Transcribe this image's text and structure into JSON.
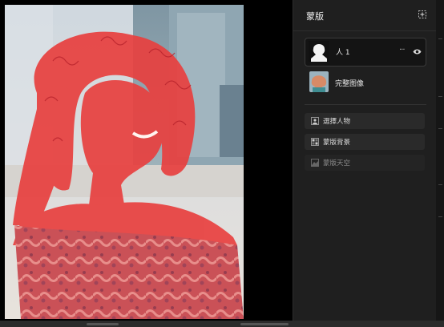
{
  "panel": {
    "title": "蒙版",
    "header_icon": "add-mask-icon"
  },
  "layers": [
    {
      "label": "人 1",
      "thumb": "person-mask-thumbnail",
      "selected": true,
      "more_label": "···",
      "visible_icon": "eye-icon"
    },
    {
      "label": "完整图像",
      "thumb": "full-image-thumbnail",
      "selected": false
    }
  ],
  "actions": [
    {
      "label": "選擇人物",
      "icon": "select-person-icon",
      "enabled": true
    },
    {
      "label": "蒙版背景",
      "icon": "mask-background-icon",
      "enabled": true
    },
    {
      "label": "蒙版天空",
      "icon": "mask-sky-icon",
      "enabled": false
    }
  ],
  "colors": {
    "mask_overlay": "#e8403f",
    "panel_bg": "#1f1f1f",
    "selected_row_bg": "#141414",
    "button_bg": "#2a2a2a"
  }
}
